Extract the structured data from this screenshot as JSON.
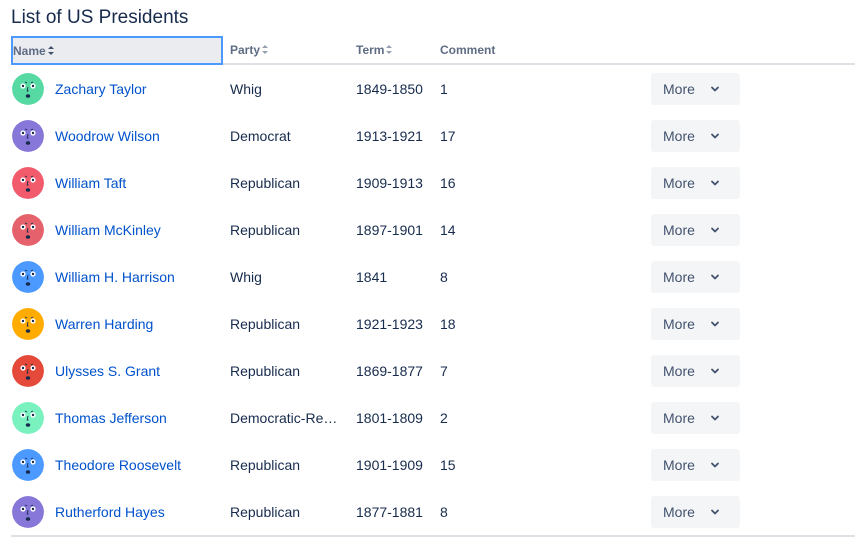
{
  "page": {
    "title": "List of US Presidents"
  },
  "table": {
    "columns": [
      {
        "label": "Name"
      },
      {
        "label": "Party"
      },
      {
        "label": "Term"
      },
      {
        "label": "Comment"
      }
    ],
    "more_label": "More",
    "rows": [
      {
        "name": "Zachary Taylor",
        "party": "Whig",
        "term": "1849-1850",
        "comment": "1",
        "avatar_color": "#57d9a3",
        "avatar_icon": "sleepy-face-icon"
      },
      {
        "name": "Woodrow Wilson",
        "party": "Democrat",
        "term": "1913-1921",
        "comment": "17",
        "avatar_color": "#8777d9",
        "avatar_icon": "surprised-face-icon"
      },
      {
        "name": "William Taft",
        "party": "Republican",
        "term": "1909-1913",
        "comment": "16",
        "avatar_color": "#f15b6c",
        "avatar_icon": "wide-eyed-face-icon"
      },
      {
        "name": "William McKinley",
        "party": "Republican",
        "term": "1897-1901",
        "comment": "14",
        "avatar_color": "#e5616b",
        "avatar_icon": "grinning-face-icon"
      },
      {
        "name": "William H. Harrison",
        "party": "Whig",
        "term": "1841",
        "comment": "8",
        "avatar_color": "#4c9aff",
        "avatar_icon": "robot-face-icon"
      },
      {
        "name": "Warren Harding",
        "party": "Republican",
        "term": "1921-1923",
        "comment": "18",
        "avatar_color": "#ffab00",
        "avatar_icon": "calm-face-icon"
      },
      {
        "name": "Ulysses S. Grant",
        "party": "Republican",
        "term": "1869-1877",
        "comment": "7",
        "avatar_color": "#e5493a",
        "avatar_icon": "monster-face-icon"
      },
      {
        "name": "Thomas Jefferson",
        "party": "Democratic-Republican",
        "term": "1801-1809",
        "comment": "2",
        "avatar_color": "#79f2c0",
        "avatar_icon": "grimace-face-icon"
      },
      {
        "name": "Theodore Roosevelt",
        "party": "Republican",
        "term": "1901-1909",
        "comment": "15",
        "avatar_color": "#4c9aff",
        "avatar_icon": "long-face-icon"
      },
      {
        "name": "Rutherford Hayes",
        "party": "Republican",
        "term": "1877-1881",
        "comment": "8",
        "avatar_color": "#8777d9",
        "avatar_icon": "surprised-face-icon"
      }
    ]
  }
}
